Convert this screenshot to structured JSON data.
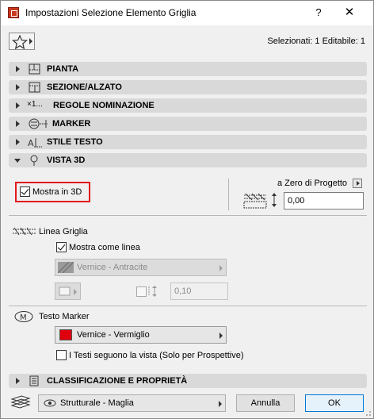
{
  "window": {
    "title": "Impostazioni Selezione Elemento Griglia",
    "help_label": "?",
    "close_label": "✕"
  },
  "header": {
    "selection_info": "Selezionati: 1 Editabile: 1"
  },
  "sections": [
    {
      "label": "PIANTA",
      "expanded": false,
      "icon": "floor-plan-icon"
    },
    {
      "label": "SEZIONE/ALZATO",
      "expanded": false,
      "icon": "section-elevation-icon"
    },
    {
      "label": "REGOLE NOMINAZIONE",
      "expanded": false,
      "icon": "naming-rules-icon",
      "icon_text": "×1..."
    },
    {
      "label": "MARKER",
      "expanded": false,
      "icon": "marker-icon"
    },
    {
      "label": "STILE TESTO",
      "expanded": false,
      "icon": "text-style-icon"
    },
    {
      "label": "VISTA 3D",
      "expanded": true,
      "icon": "3d-view-pin-icon"
    }
  ],
  "vista3d": {
    "show_in_3d_label": "Mostra in 3D",
    "show_in_3d_checked": true,
    "reference_label": "a Zero di Progetto",
    "elevation_value": "0,00",
    "grid_line": {
      "heading": "Linea Griglia",
      "show_as_line_label": "Mostra come linea",
      "show_as_line_checked": true,
      "surface_value": "Vernice - Antracite",
      "thickness_value": "0,10"
    },
    "text_marker": {
      "heading": "Testo Marker",
      "surface_value": "Vernice - Vermiglio",
      "surface_color": "#e0000d",
      "follow_view_label": "I Testi seguono la vista (Solo per Prospettive)",
      "follow_view_checked": false
    }
  },
  "classification_section": {
    "label": "CLASSIFICAZIONE E PROPRIETÀ",
    "expanded": false
  },
  "footer": {
    "layer_value": "Strutturale - Maglia",
    "cancel_label": "Annulla",
    "ok_label": "OK"
  }
}
